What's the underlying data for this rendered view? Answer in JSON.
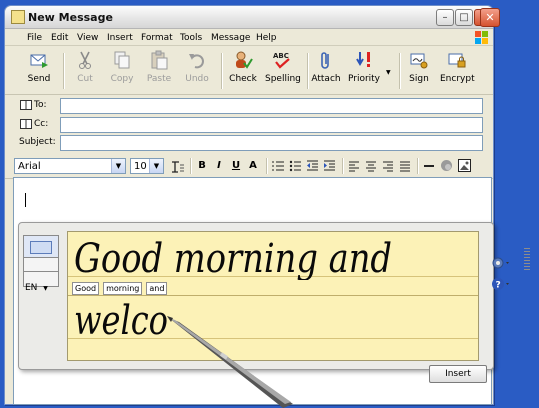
{
  "window": {
    "title": "New Message"
  },
  "menu": [
    "File",
    "Edit",
    "View",
    "Insert",
    "Format",
    "Tools",
    "Message",
    "Help"
  ],
  "toolbar": {
    "send": "Send",
    "cut": "Cut",
    "copy": "Copy",
    "paste": "Paste",
    "undo": "Undo",
    "check": "Check",
    "spelling": "Spelling",
    "attach": "Attach",
    "priority": "Priority",
    "sign": "Sign",
    "encrypt": "Encrypt"
  },
  "fields": {
    "to_label": "To:",
    "cc_label": "Cc:",
    "subject_label": "Subject:",
    "to_value": "",
    "cc_value": "",
    "subject_value": ""
  },
  "format": {
    "font": "Arial",
    "size": "10",
    "bold": "B",
    "italic": "I",
    "underline": "U",
    "fontcolor": "A"
  },
  "input_panel": {
    "language": "EN",
    "line1_ink": "Good morning and",
    "line2_ink": "welco",
    "recognized": [
      "Good",
      "morning",
      "and"
    ],
    "insert_label": "Insert"
  },
  "colors": {
    "desktop": "#2a5cc4",
    "writing_pad": "#fcf2b7",
    "close_red": "#d5532f"
  }
}
